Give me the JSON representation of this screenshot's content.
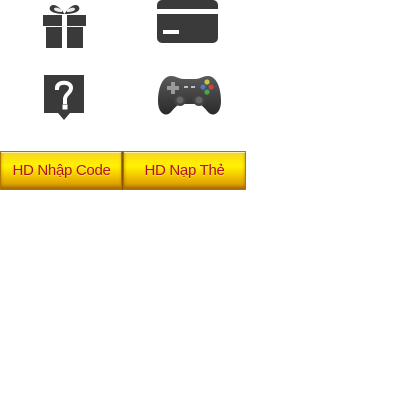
{
  "icons": {
    "gift": "gift-icon",
    "card": "credit-card-icon",
    "help": "question-icon",
    "gamepad": "gamepad-icon"
  },
  "colors": {
    "icon": "#3a3a3a",
    "button_text": "#b3121e",
    "button_gold": "#ffe30a"
  },
  "buttons": {
    "code_label": "HD Nhập Code",
    "card_label": "HD Nạp Thẻ"
  }
}
